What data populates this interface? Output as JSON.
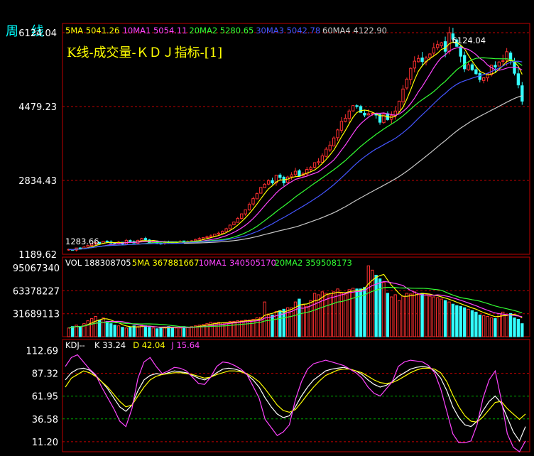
{
  "window": {
    "title_left": "周 线",
    "title_right": "K线-成交量-ＫＤＪ指标-[1]"
  },
  "colors": {
    "up": "#ff3030",
    "down": "#33ffff",
    "ma5": "#ffff00",
    "ma10": "#ff44ff",
    "ma20": "#33ff33",
    "ma30": "#4455ff",
    "ma60": "#c8c8c8",
    "grid": "#c00000"
  },
  "chart_data": [
    {
      "type": "candlestick",
      "title": "K线",
      "ylim": [
        1190,
        6330
      ],
      "ytick_labels": [
        "6124.04",
        "4479.23",
        "2834.43",
        "1189.62"
      ],
      "annotations": {
        "high": "6124.04",
        "low": "1283.66"
      },
      "legend": [
        {
          "name": "5MA",
          "value": "5041.26",
          "color": "#ffff00"
        },
        {
          "name": "10MA1",
          "value": "5054.11",
          "color": "#ff44ff"
        },
        {
          "name": "20MA2",
          "value": "5280.65",
          "color": "#33ff33"
        },
        {
          "name": "30MA3",
          "value": "5042.78",
          "color": "#4455ff"
        },
        {
          "name": "60MA4",
          "value": "4122.90",
          "color": "#c8c8c8"
        }
      ],
      "close": [
        1300,
        1283,
        1330,
        1310,
        1350,
        1390,
        1420,
        1450,
        1430,
        1480,
        1470,
        1440,
        1430,
        1460,
        1420,
        1500,
        1470,
        1440,
        1500,
        1540,
        1510,
        1450,
        1490,
        1440,
        1430,
        1460,
        1450,
        1440,
        1470,
        1480,
        1440,
        1480,
        1490,
        1520,
        1540,
        1560,
        1580,
        1600,
        1640,
        1660,
        1700,
        1760,
        1840,
        1910,
        1990,
        2090,
        2180,
        2300,
        2430,
        2540,
        2680,
        2750,
        2830,
        2780,
        2950,
        2900,
        2780,
        2910,
        2960,
        3040,
        2930,
        2980,
        3080,
        3120,
        3230,
        3250,
        3380,
        3530,
        3620,
        3780,
        3960,
        4150,
        4220,
        4380,
        4500,
        4480,
        4350,
        4290,
        4320,
        4330,
        4290,
        4130,
        4310,
        4190,
        4280,
        4380,
        4600,
        4870,
        5090,
        5330,
        5490,
        5550,
        5480,
        5560,
        5650,
        5790,
        5860,
        5900,
        5710,
        6124,
        5980,
        5820,
        5600,
        5320,
        5410,
        5300,
        5210,
        5080,
        5120,
        5210,
        5400,
        5360,
        5470,
        5500,
        5700,
        5500,
        5220,
        4960,
        4600
      ]
    },
    {
      "type": "bar",
      "title": "VOL",
      "ylim": [
        0,
        110000000
      ],
      "ytick_labels": [
        "95067340",
        "63378227",
        "31689113"
      ],
      "legend": [
        {
          "name": "VOL",
          "value": "188308705",
          "color": "#ffffff"
        },
        {
          "name": "5MA",
          "value": "367881667",
          "color": "#ffff00"
        },
        {
          "name": "10MA1",
          "value": "340505170",
          "color": "#ff44ff"
        },
        {
          "name": "20MA2",
          "value": "359508173",
          "color": "#33ff33"
        }
      ],
      "values": [
        12,
        14,
        16,
        14,
        18,
        22,
        25,
        28,
        23,
        26,
        21,
        18,
        16,
        15,
        13,
        12,
        13,
        15,
        14,
        16,
        15,
        13,
        12,
        11,
        12,
        13,
        14,
        13,
        12,
        12,
        14,
        13,
        14,
        15,
        16,
        17,
        18,
        20,
        19,
        20,
        19,
        19,
        21,
        21,
        22,
        22,
        23,
        23,
        24,
        26,
        27,
        48,
        30,
        30,
        35,
        36,
        38,
        40,
        40,
        48,
        52,
        44,
        42,
        50,
        60,
        58,
        62,
        60,
        58,
        62,
        66,
        60,
        58,
        65,
        67,
        66,
        66,
        68,
        98,
        92,
        85,
        80,
        75,
        60,
        55,
        58,
        50,
        56,
        60,
        59,
        62,
        58,
        60,
        58,
        56,
        55,
        54,
        52,
        50,
        48,
        45,
        43,
        42,
        40,
        38,
        36,
        34,
        30,
        29,
        28,
        26,
        25,
        32,
        34,
        30,
        32,
        26,
        24,
        18
      ]
    },
    {
      "type": "line",
      "title": "KDJ",
      "ylim": [
        0,
        125
      ],
      "ytick_labels": [
        "112.69",
        "87.32",
        "61.95",
        "36.58",
        "11.20"
      ],
      "legend": [
        {
          "name": "KDJ--",
          "value": "",
          "color": "#ffffff"
        },
        {
          "name": "K",
          "value": "33.24",
          "color": "#ffffff"
        },
        {
          "name": "D",
          "value": "42.04",
          "color": "#ffff00"
        },
        {
          "name": "J",
          "value": "15.64",
          "color": "#ff44ff"
        }
      ],
      "series": [
        {
          "name": "K",
          "values": [
            80,
            88,
            92,
            93,
            91,
            85,
            78,
            70,
            60,
            50,
            45,
            52,
            68,
            80,
            85,
            87,
            86,
            88,
            90,
            89,
            88,
            85,
            82,
            80,
            83,
            88,
            92,
            93,
            92,
            90,
            86,
            80,
            72,
            60,
            50,
            42,
            38,
            40,
            50,
            62,
            72,
            80,
            85,
            90,
            92,
            93,
            94,
            92,
            90,
            86,
            80,
            75,
            72,
            74,
            78,
            84,
            88,
            92,
            94,
            95,
            94,
            90,
            82,
            68,
            50,
            38,
            30,
            28,
            34,
            46,
            56,
            62,
            54,
            38,
            22,
            12,
            28
          ]
        },
        {
          "name": "D",
          "values": [
            72,
            82,
            86,
            90,
            88,
            84,
            78,
            72,
            64,
            56,
            50,
            52,
            62,
            72,
            80,
            84,
            86,
            87,
            88,
            88,
            87,
            86,
            84,
            82,
            83,
            86,
            88,
            90,
            90,
            89,
            87,
            83,
            78,
            70,
            61,
            52,
            46,
            44,
            47,
            55,
            64,
            72,
            79,
            85,
            88,
            91,
            92,
            92,
            90,
            88,
            84,
            80,
            77,
            76,
            77,
            80,
            84,
            88,
            91,
            93,
            93,
            92,
            88,
            78,
            63,
            50,
            40,
            34,
            33,
            39,
            47,
            55,
            56,
            48,
            42,
            36,
            42
          ]
        },
        {
          "name": "J",
          "values": [
            95,
            105,
            108,
            100,
            92,
            86,
            72,
            60,
            48,
            34,
            28,
            48,
            82,
            100,
            105,
            95,
            87,
            90,
            94,
            93,
            90,
            83,
            76,
            75,
            83,
            95,
            100,
            99,
            96,
            92,
            86,
            73,
            60,
            36,
            27,
            18,
            22,
            30,
            58,
            78,
            92,
            98,
            100,
            102,
            100,
            98,
            96,
            92,
            88,
            82,
            72,
            65,
            62,
            70,
            78,
            95,
            100,
            102,
            101,
            100,
            96,
            88,
            70,
            45,
            20,
            10,
            10,
            12,
            30,
            60,
            80,
            90,
            58,
            20,
            5,
            0,
            12
          ]
        }
      ]
    }
  ]
}
